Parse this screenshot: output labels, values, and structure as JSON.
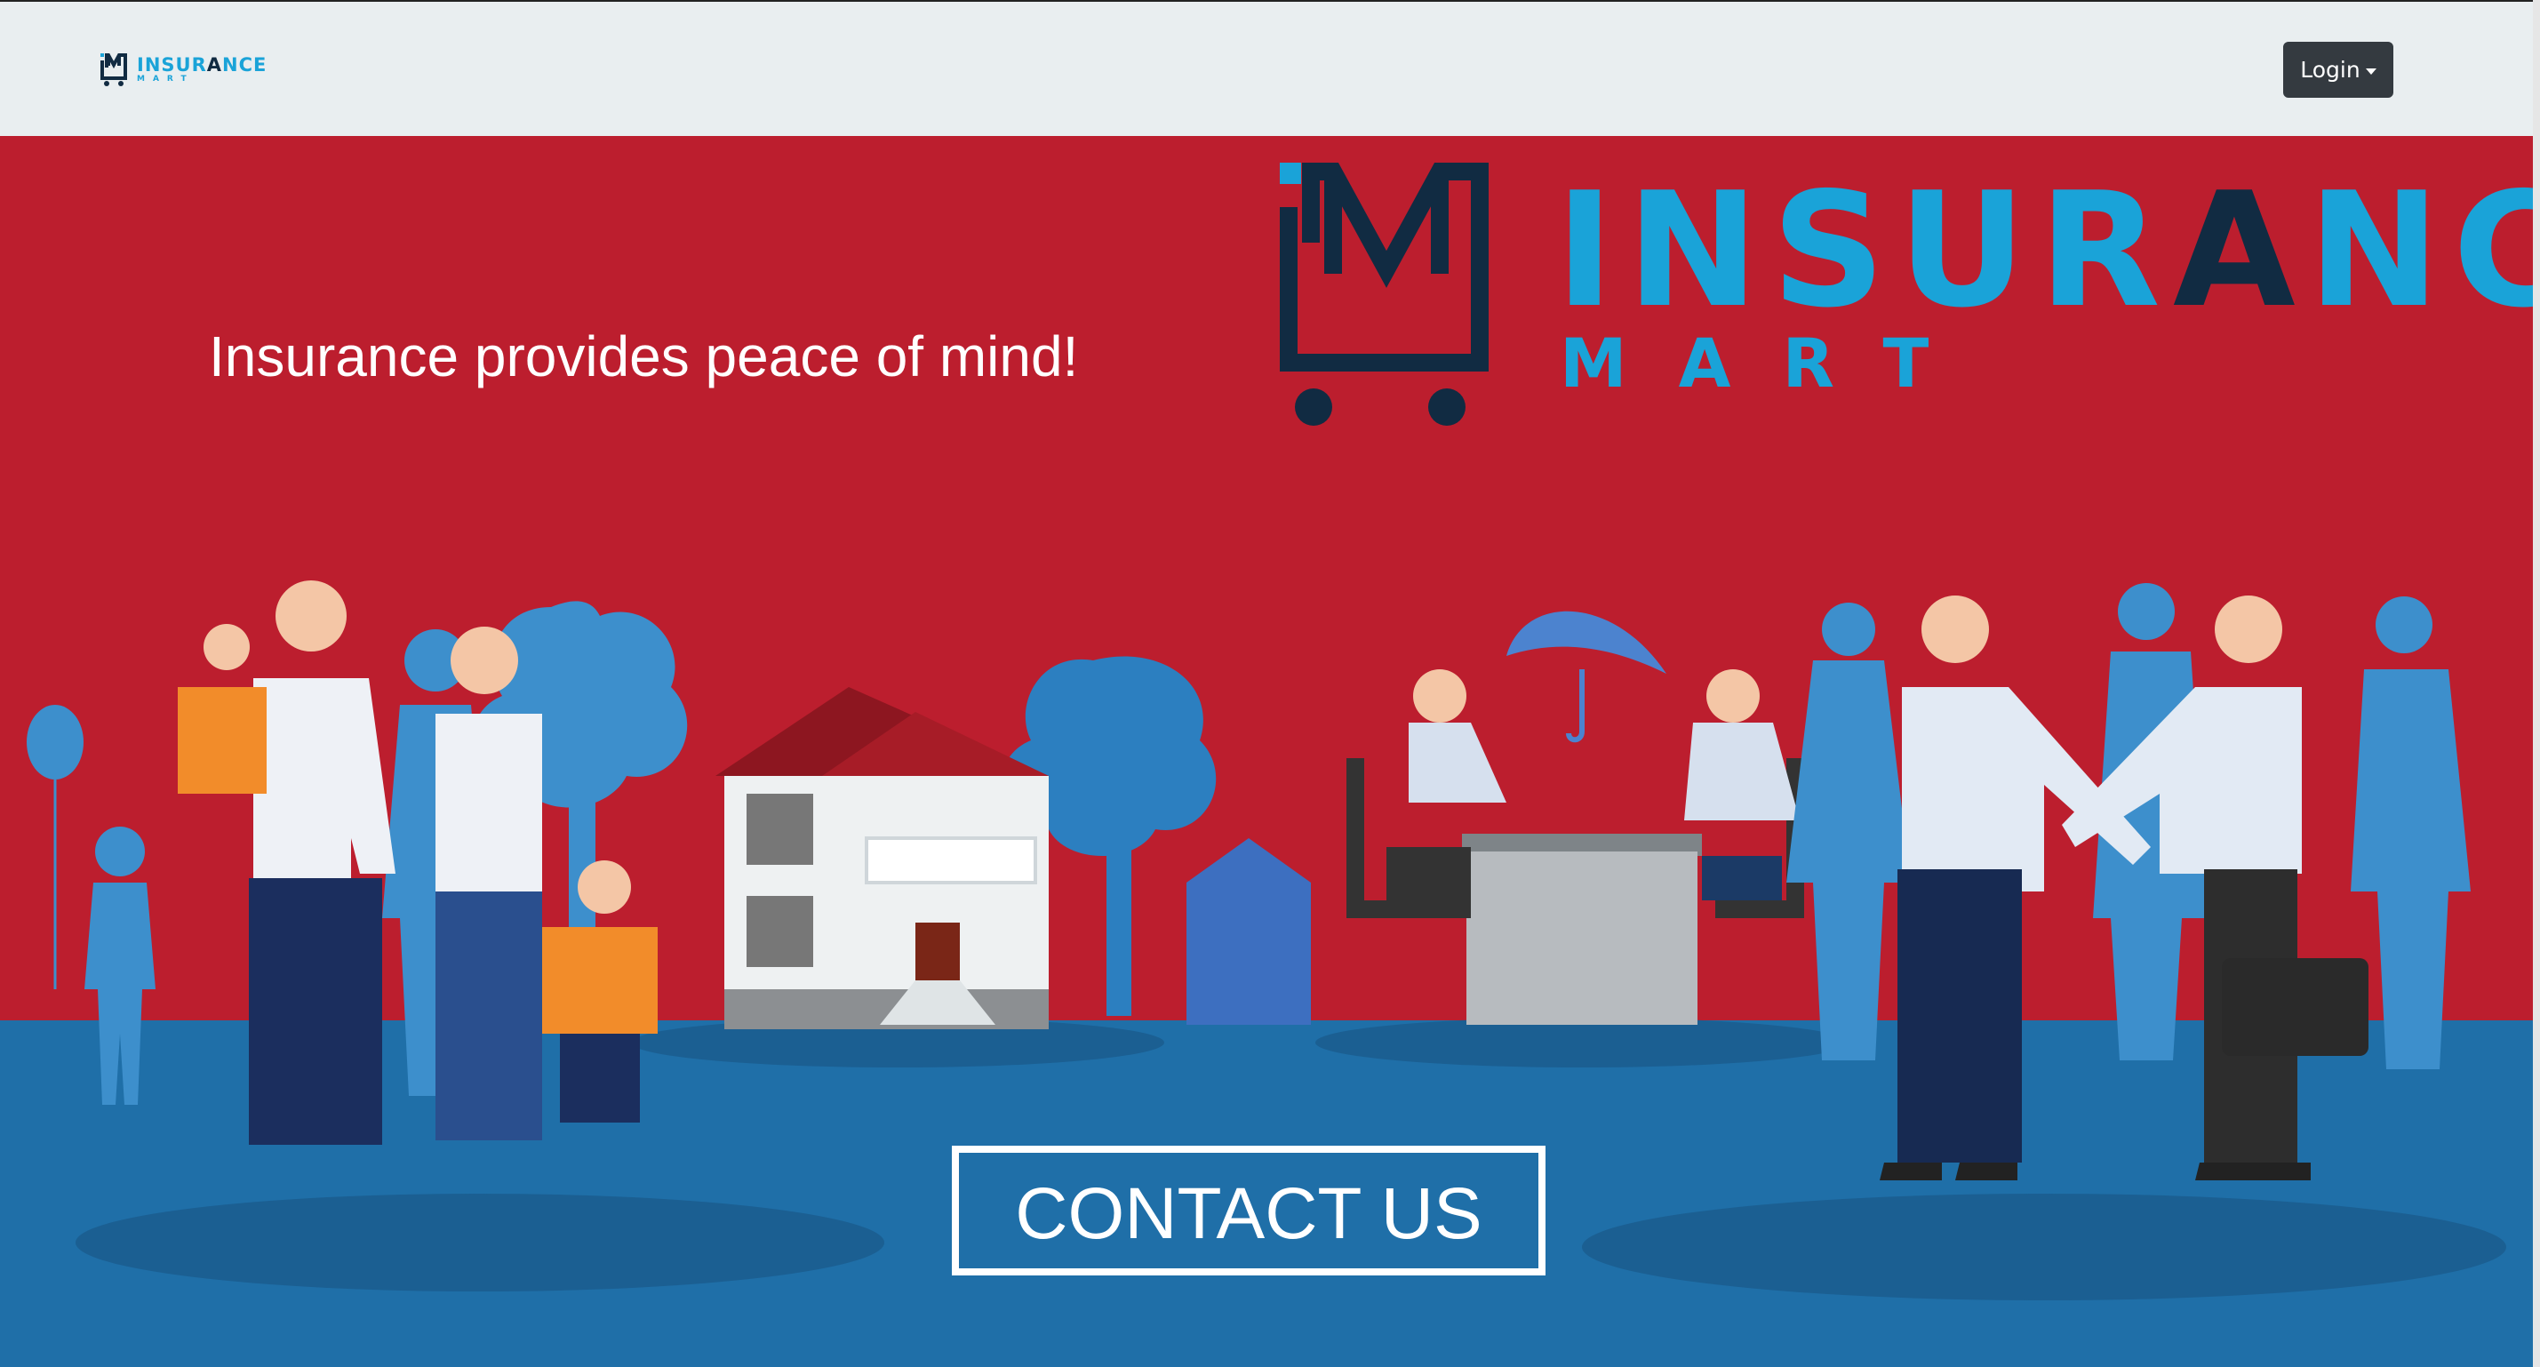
{
  "navbar": {
    "brand_word_part1": "INSUR",
    "brand_word_part2": "A",
    "brand_word_part3": "NCE",
    "brand_sub": "MART",
    "login_label": "Login"
  },
  "banner": {
    "tagline": "Insurance provides peace of mind!",
    "logo_word_part1": "INSUR",
    "logo_word_part2": "A",
    "logo_word_part3": "NCE",
    "logo_sub": "MART",
    "contact_label": "CONTACT US"
  },
  "colors": {
    "brand_blue": "#1aa3d8",
    "brand_navy": "#112b42",
    "banner_red": "#bc1e2e",
    "ground_blue": "#1f6fa8",
    "navbar_bg": "#e9eef0",
    "button_dark": "#343a40"
  },
  "icons": {
    "brand_logo": "cart-m-logo-icon",
    "login_caret": "caret-down-icon"
  }
}
